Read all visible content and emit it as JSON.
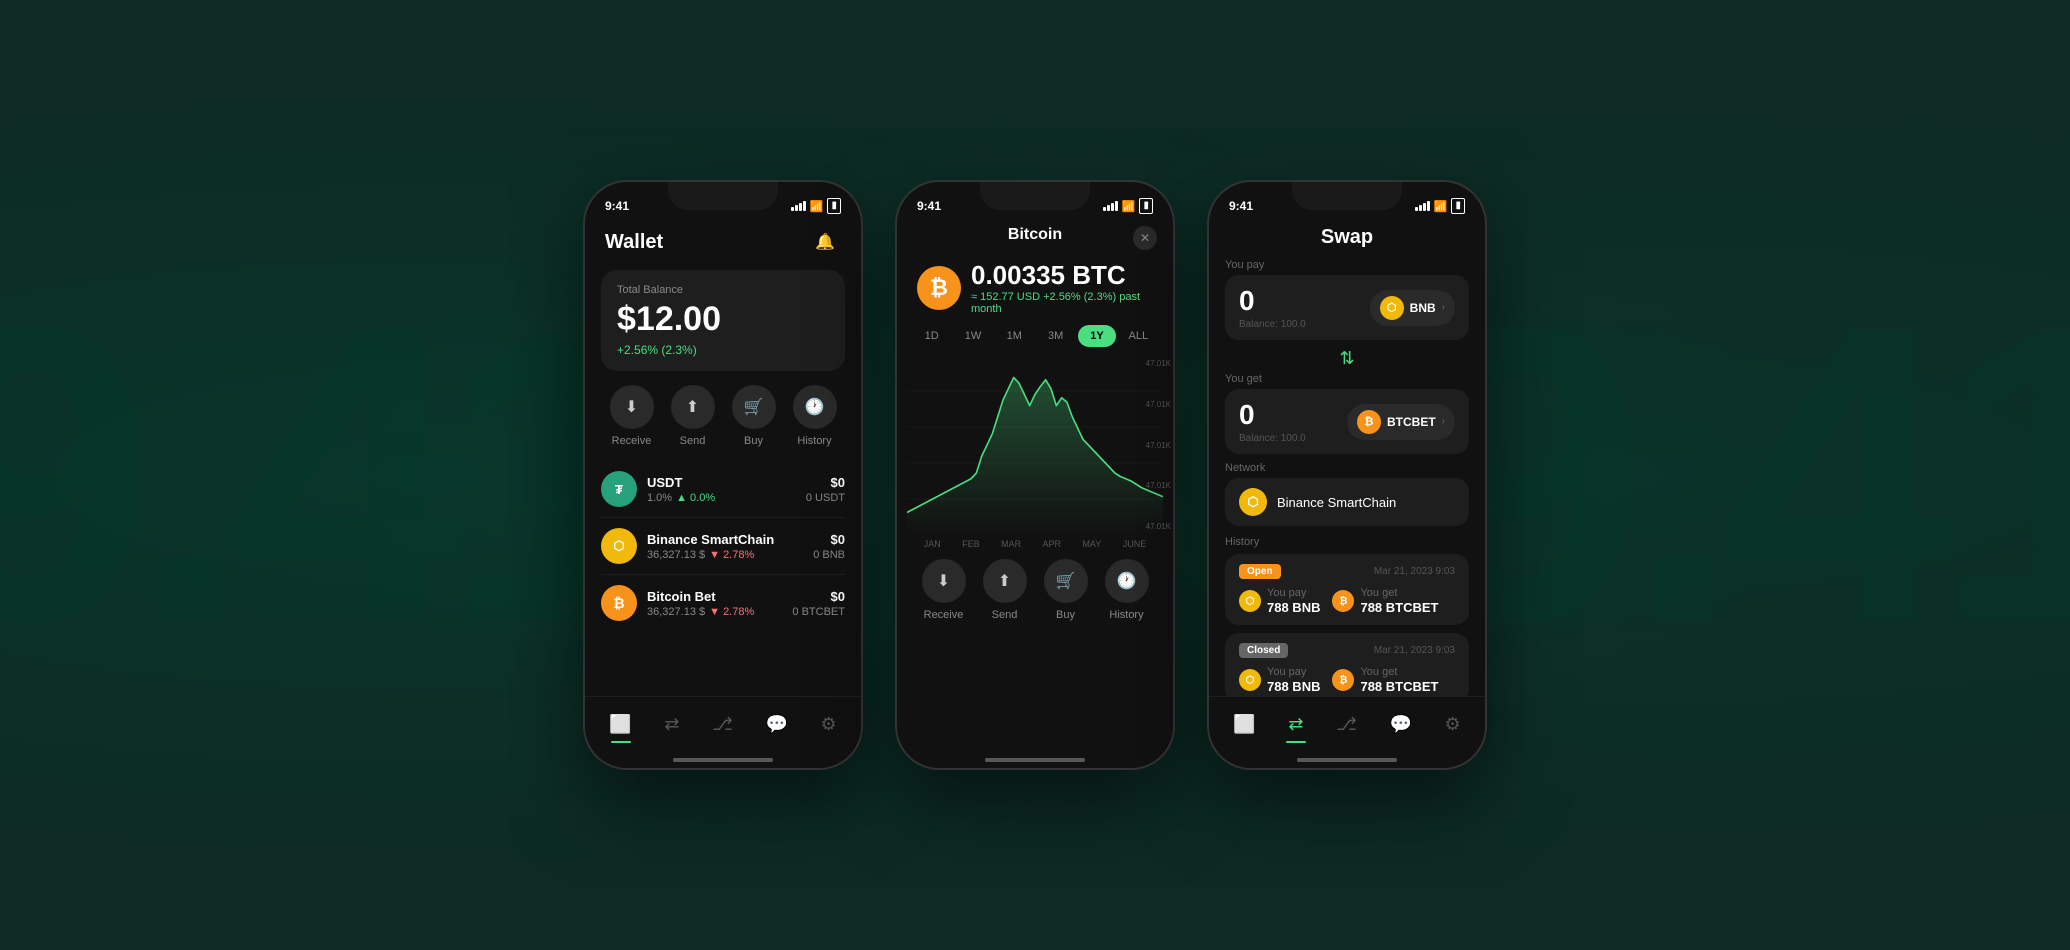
{
  "background": {
    "left_text": "9.41",
    "right_text": "9.41"
  },
  "phone1": {
    "status_time": "9:41",
    "title": "Wallet",
    "balance_label": "Total Balance",
    "balance_amount": "$12.00",
    "balance_change": "+2.56% (2.3%)",
    "actions": [
      {
        "label": "Receive",
        "icon": "↙"
      },
      {
        "label": "Send",
        "icon": "↗"
      },
      {
        "label": "Buy",
        "icon": "🛍"
      },
      {
        "label": "History",
        "icon": "🕐"
      }
    ],
    "tokens": [
      {
        "name": "USDT",
        "price": "1.0%",
        "change": "+0.0%",
        "change_dir": "up",
        "usd": "$0",
        "amount": "0 USDT",
        "color": "#26a17b"
      },
      {
        "name": "Binance SmartChain",
        "price": "36,327.13",
        "change": "▼ 2.78%",
        "change_dir": "down",
        "usd": "$0",
        "amount": "0 BNB",
        "color": "#f0b90b"
      },
      {
        "name": "Bitcoin Bet",
        "price": "36,327.13",
        "change": "▼ 2.78%",
        "change_dir": "down",
        "usd": "$0",
        "amount": "0 BTCBET",
        "color": "#f7931a"
      }
    ],
    "nav_items": [
      "wallet",
      "swap",
      "share",
      "chat",
      "settings"
    ]
  },
  "phone2": {
    "status_time": "9:41",
    "title": "Bitcoin",
    "btc_amount": "0.00335 BTC",
    "btc_usd": "≈ 152.77 USD",
    "btc_change": "+2.56% (2.3%) past month",
    "periods": [
      "1D",
      "1W",
      "1M",
      "3M",
      "1Y",
      "ALL"
    ],
    "active_period": "1Y",
    "chart_y_labels": [
      "47.01K",
      "47.01K",
      "47.01K",
      "47.01K",
      "47.01K"
    ],
    "chart_x_labels": [
      "JAN",
      "FEB",
      "MAR",
      "APR",
      "MAY",
      "JUNE"
    ],
    "actions": [
      {
        "label": "Receive",
        "icon": "↙"
      },
      {
        "label": "Send",
        "icon": "↗"
      },
      {
        "label": "Buy",
        "icon": "🛍"
      },
      {
        "label": "History",
        "icon": "🕐"
      }
    ]
  },
  "phone3": {
    "status_time": "9:41",
    "title": "Swap",
    "you_pay_label": "You pay",
    "you_pay_amount": "0",
    "you_pay_token": "BNB",
    "you_pay_balance": "Balance: 100.0",
    "you_get_label": "You get",
    "you_get_amount": "0",
    "you_get_token": "BTCBET",
    "you_get_balance": "Balance: 100.0",
    "network_label": "Network",
    "network_name": "Binance SmartChain",
    "history_label": "History",
    "history_items": [
      {
        "status": "Open",
        "status_class": "open",
        "date": "Mar 21, 2023 9:03",
        "pay_label": "You pay",
        "pay_amount": "788 BNB",
        "get_label": "You get",
        "get_amount": "788 BTCBET"
      },
      {
        "status": "Closed",
        "status_class": "closed",
        "date": "Mar 21, 2023 9:03",
        "pay_label": "You pay",
        "pay_amount": "788 BNB",
        "get_label": "You get",
        "get_amount": "788 BTCBET"
      }
    ],
    "nav_items": [
      "wallet",
      "swap",
      "share",
      "chat",
      "settings"
    ]
  }
}
